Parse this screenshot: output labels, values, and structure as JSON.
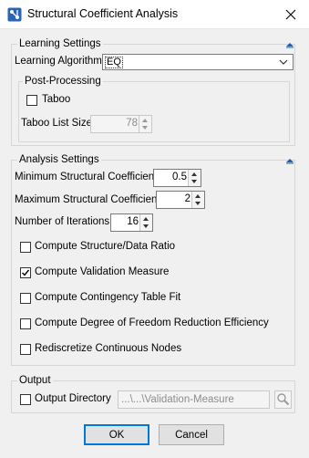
{
  "window": {
    "title": "Structural Coefficient Analysis"
  },
  "learning_settings": {
    "title": "Learning Settings",
    "algorithm_label": "Learning Algorithm",
    "algorithm_value": "EQ",
    "post_processing": {
      "title": "Post-Processing",
      "taboo_label": "Taboo",
      "taboo_checked": false,
      "taboo_list_size_label": "Taboo List Size",
      "taboo_list_size_value": "78"
    }
  },
  "analysis_settings": {
    "title": "Analysis Settings",
    "min_coef_label": "Minimum Structural Coefficient",
    "min_coef_value": "0.5",
    "max_coef_label": "Maximum Structural Coefficient",
    "max_coef_value": "2",
    "iterations_label": "Number of Iterations",
    "iterations_value": "16",
    "options": [
      {
        "label": "Compute Structure/Data Ratio",
        "checked": false
      },
      {
        "label": "Compute Validation Measure",
        "checked": true
      },
      {
        "label": "Compute Contingency Table Fit",
        "checked": false
      },
      {
        "label": "Compute Degree of Freedom Reduction Efficiency",
        "checked": false
      },
      {
        "label": "Rediscretize Continuous Nodes",
        "checked": false
      }
    ]
  },
  "output": {
    "title": "Output",
    "directory_label": "Output Directory",
    "directory_checked": false,
    "directory_value": "...\\...\\Validation-Measure"
  },
  "buttons": {
    "ok": "OK",
    "cancel": "Cancel"
  },
  "colors": {
    "accent": "#0078d7",
    "group_border": "#d6d6d6",
    "background": "#f0f0f0"
  }
}
